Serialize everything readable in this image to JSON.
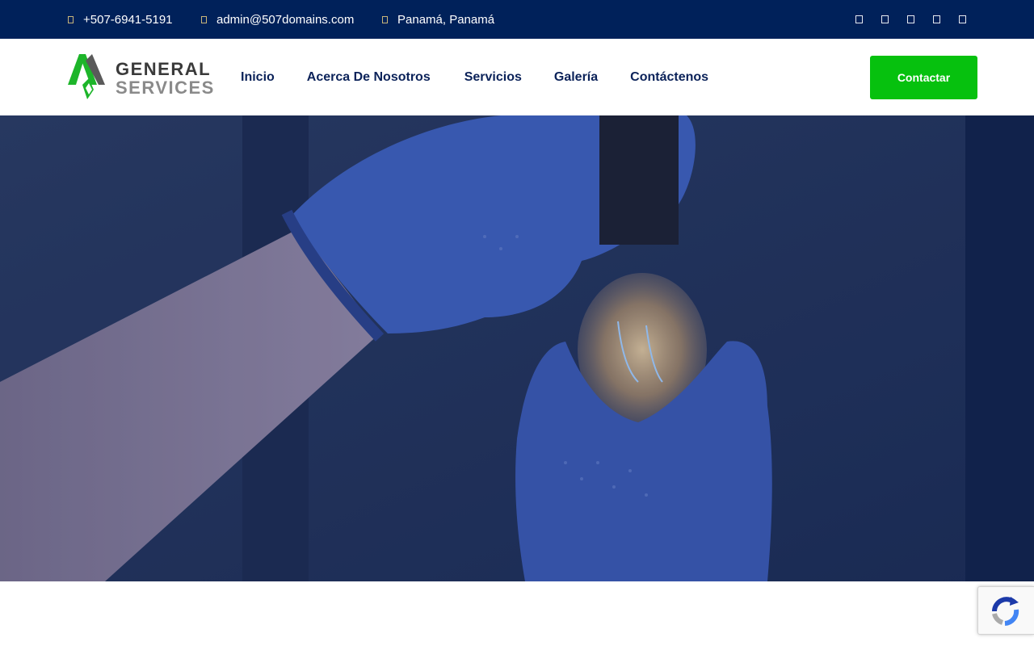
{
  "topbar": {
    "phone": "+507-6941-5191",
    "email": "admin@507domains.com",
    "location": "Panamá, Panamá",
    "social_icons": [
      "facebook-icon",
      "twitter-icon",
      "instagram-icon",
      "linkedin-icon",
      "youtube-icon"
    ]
  },
  "header": {
    "logo_line1": "GENERAL",
    "logo_line2": "SERVICES",
    "nav": [
      "Inicio",
      "Acerca De Nosotros",
      "Servicios",
      "Galería",
      "Contáctenos"
    ],
    "cta_label": "Contactar"
  },
  "colors": {
    "topbar_bg": "#00215a",
    "nav_text": "#0b2259",
    "cta_bg": "#06c10e",
    "logo_green": "#1db52a",
    "hero_overlay": "#1b3c8a"
  },
  "hero": {
    "image": "gloved-hands-holding-light-bulb"
  }
}
